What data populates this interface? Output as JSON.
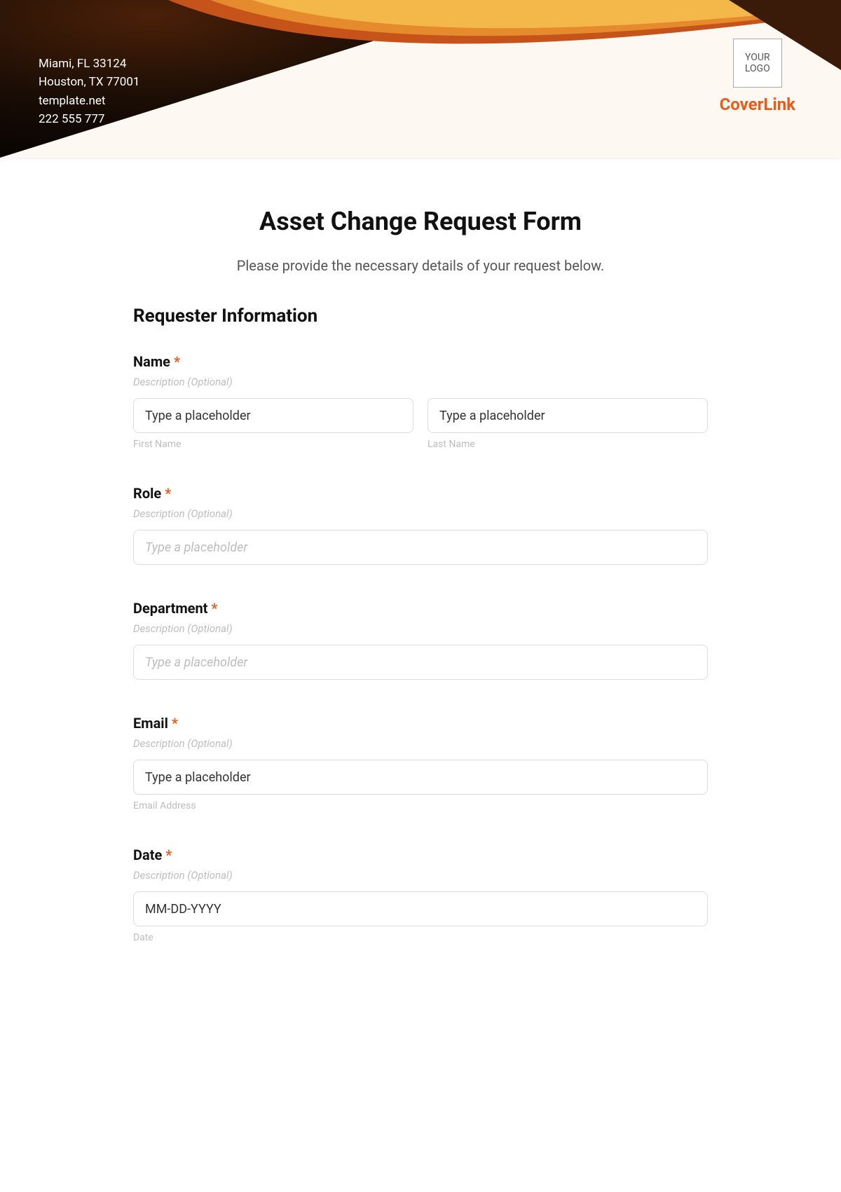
{
  "header": {
    "address1": "Miami, FL 33124",
    "address2": "Houston, TX 77001",
    "website": "template.net",
    "phone": "222 555 777",
    "logo_text": "YOUR LOGO",
    "brand": "CoverLink"
  },
  "form": {
    "title": "Asset Change Request Form",
    "subtitle": "Please provide the necessary details of your request below.",
    "section_heading": "Requester Information",
    "fields": {
      "name": {
        "label": "Name",
        "required": "*",
        "desc": "Description (Optional)",
        "first_placeholder": "Type a placeholder",
        "first_sub": "First Name",
        "last_placeholder": "Type a placeholder",
        "last_sub": "Last Name"
      },
      "role": {
        "label": "Role",
        "required": "*",
        "desc": "Description (Optional)",
        "placeholder": "Type a placeholder"
      },
      "department": {
        "label": "Department",
        "required": "*",
        "desc": "Description (Optional)",
        "placeholder": "Type a placeholder"
      },
      "email": {
        "label": "Email",
        "required": "*",
        "desc": "Description (Optional)",
        "placeholder": "Type a placeholder",
        "sub": "Email Address"
      },
      "date": {
        "label": "Date",
        "required": "*",
        "desc": "Description (Optional)",
        "placeholder": "MM-DD-YYYY",
        "sub": "Date"
      }
    }
  }
}
